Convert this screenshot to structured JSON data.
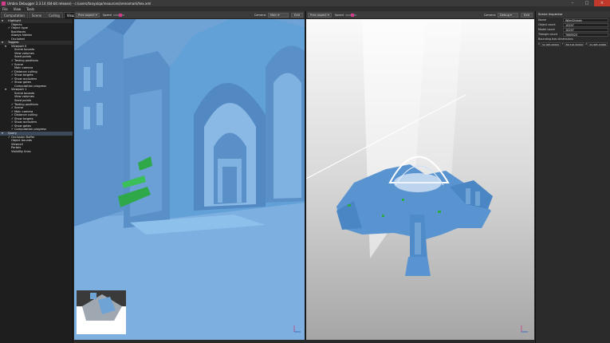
{
  "window": {
    "title": "Umbra Debugger 3.3.14 (64-bit release) - c:/users/tanya/qa/resources/arenamark/hex.xml"
  },
  "menu": [
    "File",
    "View",
    "Tools"
  ],
  "left_tabs": [
    {
      "label": "Computation",
      "active": false
    },
    {
      "label": "Scene",
      "active": false
    },
    {
      "label": "Culling",
      "active": false
    },
    {
      "label": "Visualizations",
      "active": true
    }
  ],
  "tree": [
    {
      "label": "Highlight",
      "level": 0,
      "check": false,
      "arrow": "▼",
      "section": true
    },
    {
      "label": "Objects",
      "level": 2,
      "check": false
    },
    {
      "label": "Object type",
      "level": 2,
      "check": true
    },
    {
      "label": "Backfaces",
      "level": 2,
      "check": false
    },
    {
      "label": "Always hidden",
      "level": 2,
      "check": false
    },
    {
      "label": "Occluded",
      "level": 2,
      "check": false
    },
    {
      "label": "Toggles",
      "level": 0,
      "check": false,
      "arrow": "▼",
      "section": true
    },
    {
      "label": "Viewport 0",
      "level": 1,
      "check": false,
      "arrow": "▼"
    },
    {
      "label": "Scene bounds",
      "level": 3,
      "check": false
    },
    {
      "label": "View volumes",
      "level": 3,
      "check": false
    },
    {
      "label": "Seed points",
      "level": 3,
      "check": false
    },
    {
      "label": "Testing positions",
      "level": 3,
      "check": true
    },
    {
      "label": "Scene",
      "level": 3,
      "check": true
    },
    {
      "label": "Main camera",
      "level": 3,
      "check": false
    },
    {
      "label": "Distance culling",
      "level": 3,
      "check": true
    },
    {
      "label": "Show targets",
      "level": 3,
      "check": true
    },
    {
      "label": "Show occluders",
      "level": 3,
      "check": true
    },
    {
      "label": "Show gates",
      "level": 3,
      "check": true
    },
    {
      "label": "Computation progress",
      "level": 3,
      "check": false
    },
    {
      "label": "Viewport 1",
      "level": 1,
      "check": false,
      "arrow": "▼"
    },
    {
      "label": "Scene bounds",
      "level": 3,
      "check": false
    },
    {
      "label": "View volumes",
      "level": 3,
      "check": false
    },
    {
      "label": "Seed points",
      "level": 3,
      "check": false
    },
    {
      "label": "Testing positions",
      "level": 3,
      "check": true
    },
    {
      "label": "Scene",
      "level": 3,
      "check": true
    },
    {
      "label": "Main camera",
      "level": 3,
      "check": true
    },
    {
      "label": "Distance culling",
      "level": 3,
      "check": true
    },
    {
      "label": "Show targets",
      "level": 3,
      "check": true
    },
    {
      "label": "Show occluders",
      "level": 3,
      "check": true
    },
    {
      "label": "Show gates",
      "level": 3,
      "check": true
    },
    {
      "label": "Computation progress",
      "level": 3,
      "check": true
    },
    {
      "label": "Query",
      "level": 0,
      "check": false,
      "arrow": "▼",
      "section": true,
      "selected": true
    },
    {
      "label": "Occlusion Buffer",
      "level": 2,
      "check": true
    },
    {
      "label": "Object bounds",
      "level": 2,
      "check": false
    },
    {
      "label": "Viewcell",
      "level": 2,
      "check": false
    },
    {
      "label": "Portals",
      "level": 2,
      "check": false
    },
    {
      "label": "Visibility lines",
      "level": 2,
      "check": false
    }
  ],
  "viewports": [
    {
      "aspect": "Pres aspect",
      "speed_label": "Speed",
      "camera_label": "Camera:",
      "camera_value": "Main",
      "edit_label": "Edit"
    },
    {
      "aspect": "Pres aspect",
      "speed_label": "Speed",
      "camera_label": "Camera:",
      "camera_value": "Debug",
      "edit_label": "Edit"
    }
  ],
  "inspector": {
    "title": "Scene Inspector",
    "rows": [
      {
        "key": "Name",
        "value": "WilmShimdy"
      },
      {
        "key": "Object count",
        "value": "10297"
      },
      {
        "key": "Model count",
        "value": "10297"
      },
      {
        "key": "Triangle count",
        "value": "7669525"
      }
    ],
    "bbox_label": "Bounding box dimensions",
    "bbox": [
      {
        "axis": "X",
        "value": "52.965.00000"
      },
      {
        "axis": "Y",
        "value": "86.516.00000"
      },
      {
        "axis": "Z",
        "value": "52.965.00000"
      }
    ]
  },
  "colors": {
    "accent": "#d23c8c",
    "main_view_blue": "#6fa3d6",
    "geometry_blue": "#5a94d0",
    "occluder_green": "#2fa84a"
  }
}
